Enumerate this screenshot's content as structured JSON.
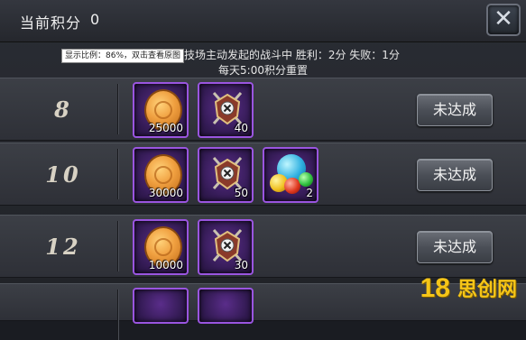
{
  "header": {
    "title": "当前积分",
    "score": "0",
    "close_label": "✕"
  },
  "tooltip": "显示比例：86%，双击查看原图",
  "rules": {
    "line1": "在竞技场主动发起的战斗中   胜利：2分  失败：1分",
    "line2": "每天5:00积分重置"
  },
  "rows": [
    {
      "points": "8",
      "status": "未达成",
      "items": [
        {
          "icon": "gold-coin-icon",
          "qty": "25000"
        },
        {
          "icon": "arena-badge-icon",
          "qty": "40"
        }
      ]
    },
    {
      "points": "10",
      "status": "未达成",
      "items": [
        {
          "icon": "gold-coin-icon",
          "qty": "30000"
        },
        {
          "icon": "arena-badge-icon",
          "qty": "50"
        },
        {
          "icon": "gem-cluster-icon",
          "qty": "2"
        }
      ]
    },
    {
      "points": "12",
      "status": "未达成",
      "items": [
        {
          "icon": "gold-coin-icon",
          "qty": "10000"
        },
        {
          "icon": "arena-badge-icon",
          "qty": "30"
        }
      ]
    }
  ],
  "watermark": {
    "number": "18",
    "text": "思创网"
  },
  "colors": {
    "item_border": "#9a55e0",
    "coin": "#f0a040",
    "watermark": "#f5c518"
  }
}
